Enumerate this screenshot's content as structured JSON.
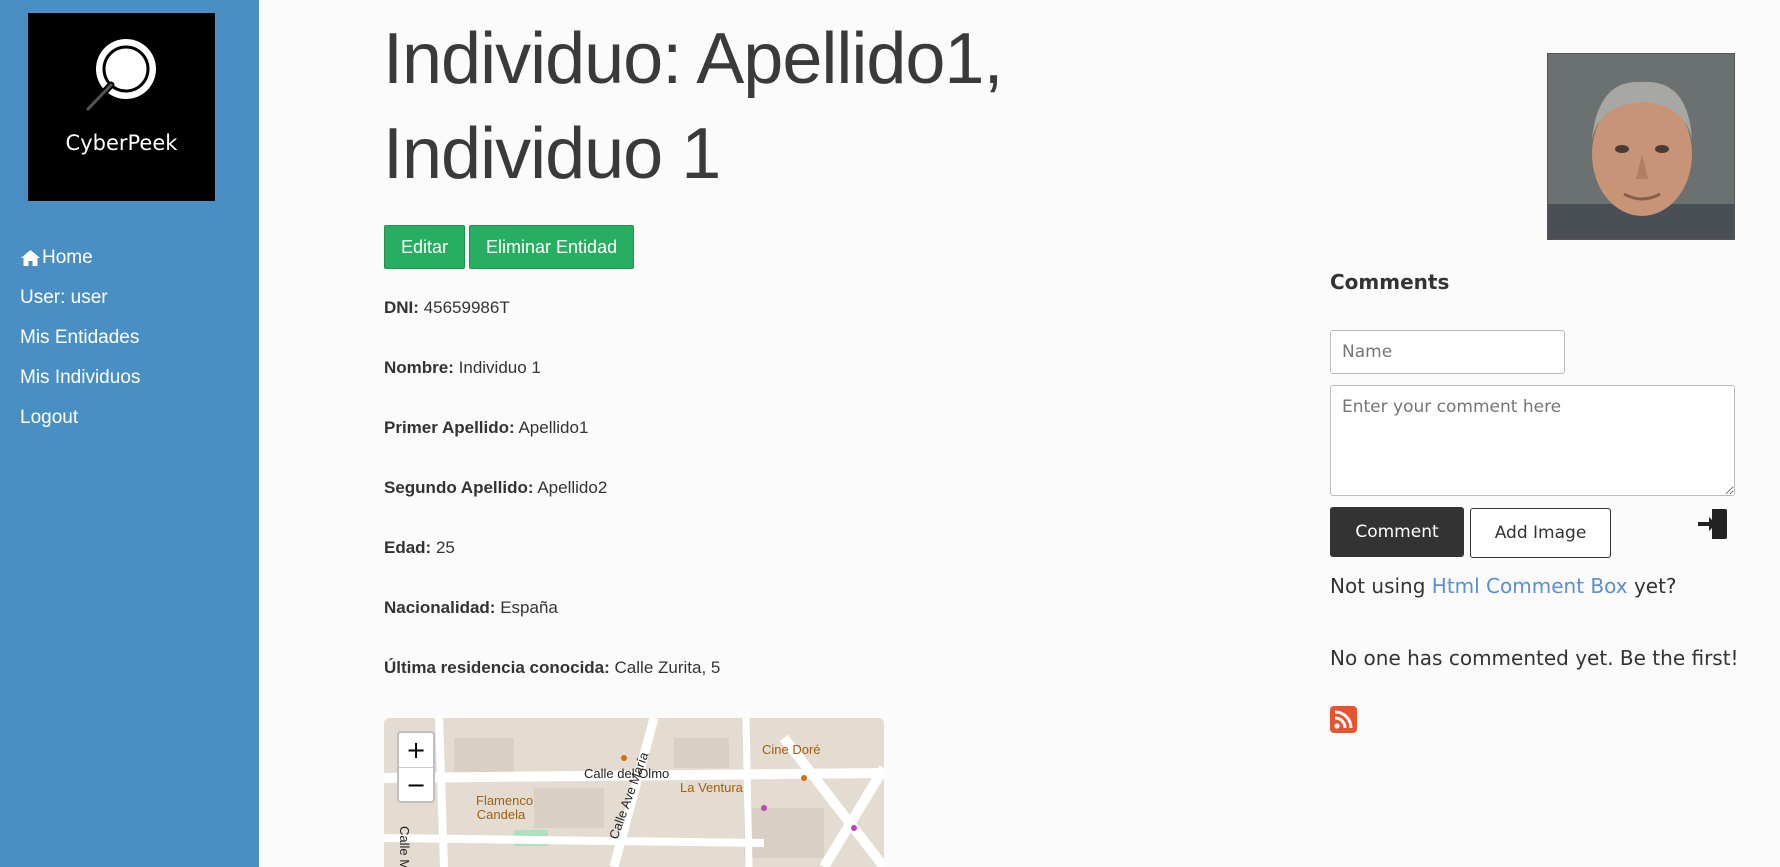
{
  "sidebar": {
    "logo_text": "CyberPeek",
    "nav": [
      {
        "label": "Home",
        "icon": "home-icon"
      },
      {
        "label": "User: user"
      },
      {
        "label": "Mis Entidades"
      },
      {
        "label": "Mis Individuos"
      },
      {
        "label": "Logout"
      }
    ]
  },
  "page": {
    "title": "Individuo: Apellido1, Individuo 1",
    "buttons": {
      "edit": "Editar",
      "delete": "Eliminar Entidad"
    },
    "fields": [
      {
        "label": "DNI:",
        "value": "45659986T"
      },
      {
        "label": "Nombre:",
        "value": "Individuo 1"
      },
      {
        "label": "Primer Apellido:",
        "value": "Apellido1"
      },
      {
        "label": "Segundo Apellido:",
        "value": "Apellido2"
      },
      {
        "label": "Edad:",
        "value": "25"
      },
      {
        "label": "Nacionalidad:",
        "value": "España"
      },
      {
        "label": "Última residencia conocida:",
        "value": "Calle Zurita, 5"
      }
    ]
  },
  "map": {
    "zoom_in": "+",
    "zoom_out": "−",
    "labels": [
      "Calle del Olmo",
      "Flamenco Candela",
      "La Ventura",
      "Cine Doré",
      "Calle Ave María",
      "Calle M"
    ]
  },
  "comments": {
    "title": "Comments",
    "name_placeholder": "Name",
    "comment_placeholder": "Enter your comment here",
    "comment_button": "Comment",
    "add_image_button": "Add Image",
    "not_using_prefix": "Not using",
    "not_using_link": "Html Comment Box",
    "not_using_suffix": "yet?",
    "no_comments": "No one has commented yet. Be the first!"
  },
  "colors": {
    "sidebar": "#4a8fc4",
    "green": "#27ae60",
    "link": "#5b8ed6",
    "rss": "#e8542f"
  }
}
